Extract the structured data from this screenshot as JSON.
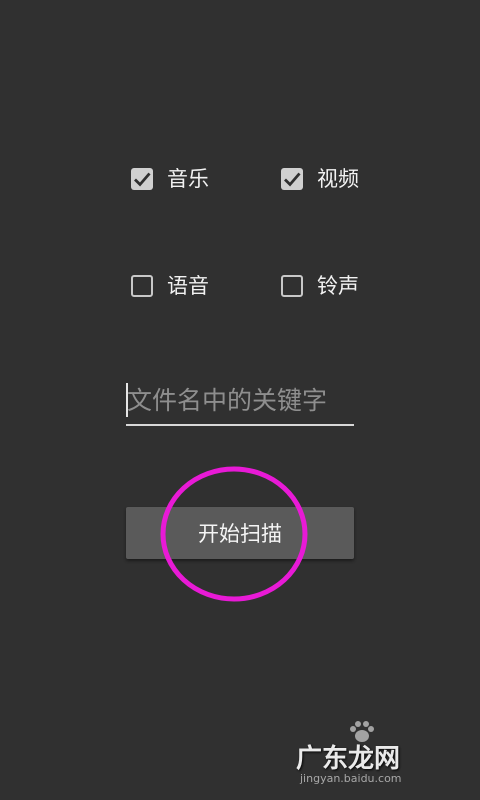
{
  "options": [
    {
      "label": "音乐",
      "checked": true
    },
    {
      "label": "视频",
      "checked": true
    },
    {
      "label": "语音",
      "checked": false
    },
    {
      "label": "铃声",
      "checked": false
    }
  ],
  "keyword_field": {
    "value": "",
    "placeholder": "文件名中的关键字"
  },
  "scan_button": {
    "label": "开始扫描"
  },
  "annotation": {
    "color": "#e81ad6"
  },
  "watermark": {
    "brand": "广东龙网",
    "url": "jingyan.baidu.com"
  },
  "colors": {
    "background": "#303030",
    "button": "#5a5a5a",
    "checkbox_checked": "#d0d0d0",
    "placeholder": "#8e8e8e"
  }
}
